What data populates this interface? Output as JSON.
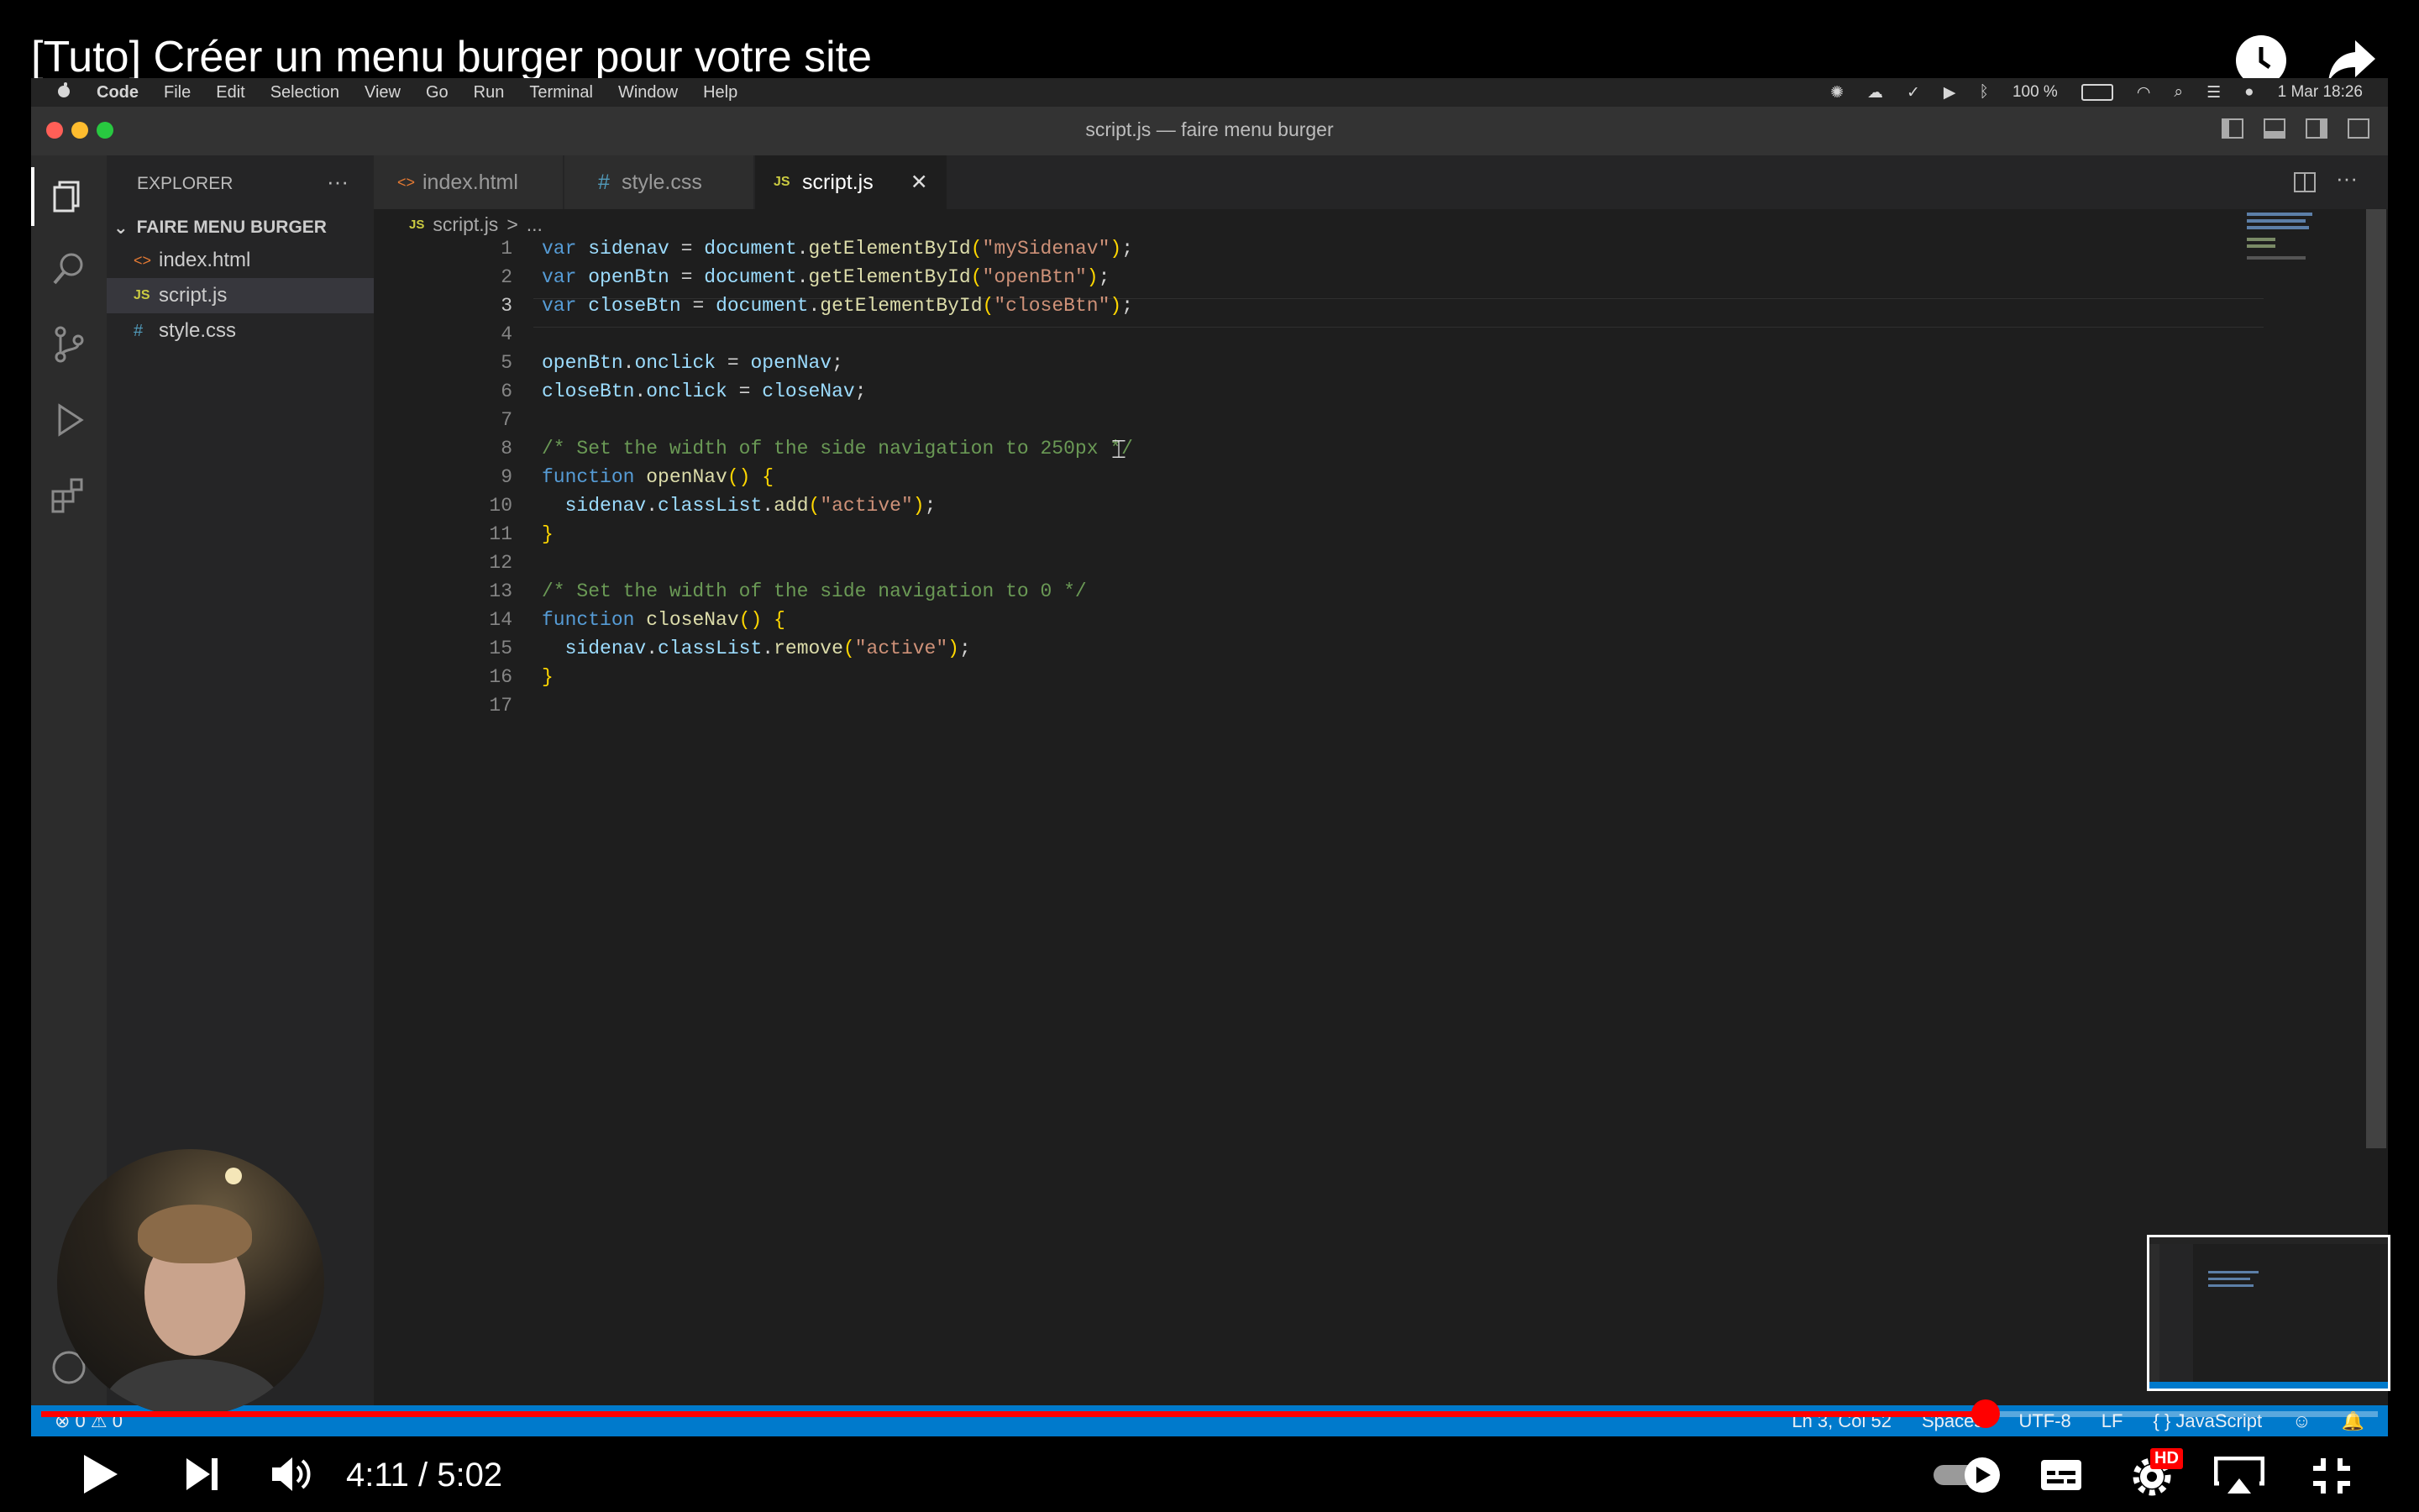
{
  "player": {
    "title": "[Tuto] Créer un menu burger pour votre site",
    "time": "4:11 / 5:02",
    "progress": 0.832,
    "hd_badge": "HD"
  },
  "mac_menubar": {
    "apple": "",
    "items": [
      "Code",
      "File",
      "Edit",
      "Selection",
      "View",
      "Go",
      "Run",
      "Terminal",
      "Window",
      "Help"
    ],
    "battery": "100 %",
    "datetime": "1 Mar  18:26"
  },
  "vscode": {
    "window_title": "script.js — faire menu burger",
    "explorer_label": "EXPLORER",
    "explorer_more": "···",
    "project_name": "FAIRE MENU BURGER",
    "files": [
      {
        "icon": "<>",
        "name": "index.html"
      },
      {
        "icon": "JS",
        "name": "script.js"
      },
      {
        "icon": "#",
        "name": "style.css"
      }
    ],
    "tabs": [
      {
        "icon": "<>",
        "label": "index.html"
      },
      {
        "icon": "#",
        "label": "style.css"
      },
      {
        "icon": "JS",
        "label": "script.js",
        "close": "✕"
      }
    ],
    "breadcrumb": {
      "icon": "JS",
      "file": "script.js",
      "sep": ">",
      "rest": "..."
    },
    "line_numbers": [
      "1",
      "2",
      "3",
      "4",
      "5",
      "6",
      "7",
      "8",
      "9",
      "10",
      "11",
      "12",
      "13",
      "14",
      "15",
      "16",
      "17"
    ],
    "status": {
      "problems": "⊗ 0 ⚠ 0",
      "position": "Ln 3, Col 52",
      "spaces": "Spaces:",
      "encoding": "UTF-8",
      "eol": "LF",
      "language": "{ } JavaScript"
    }
  }
}
